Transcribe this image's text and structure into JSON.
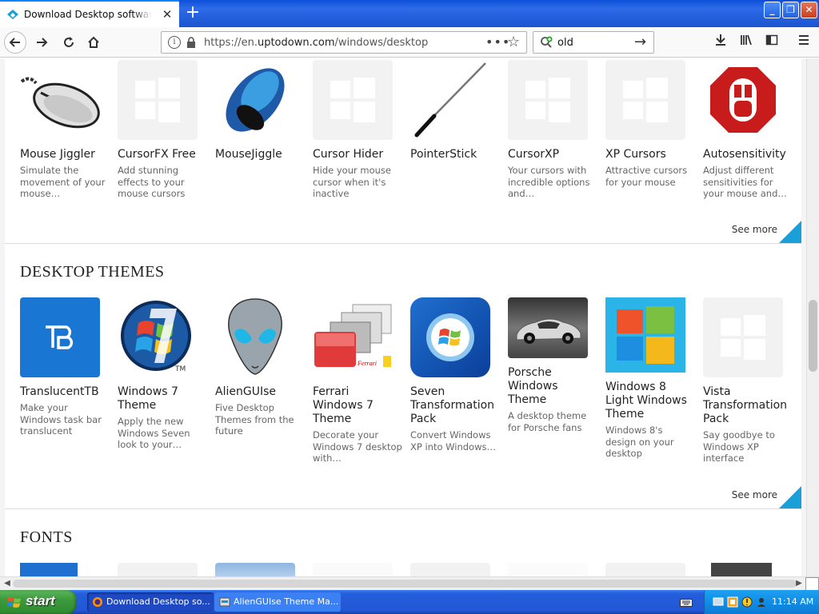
{
  "browser": {
    "tab_title": "Download Desktop software for Windows",
    "url_scheme": "https://en.",
    "url_host": "uptodown.com",
    "url_path": "/windows/desktop",
    "search_value": "old"
  },
  "sections": [
    {
      "title": "",
      "see_more": "See more",
      "items": [
        {
          "name": "Mouse Jiggler",
          "desc": "Simulate the movement of your mouse…",
          "icon": "pixel-mouse-icon"
        },
        {
          "name": "CursorFX Free",
          "desc": "Add stunning effects to your mouse cursors",
          "icon": "windows-placeholder-icon"
        },
        {
          "name": "MouseJiggle",
          "desc": "",
          "icon": "blue-mouse-icon"
        },
        {
          "name": "Cursor Hider",
          "desc": "Hide your mouse cursor when it's inactive",
          "icon": "windows-placeholder-icon"
        },
        {
          "name": "PointerStick",
          "desc": "",
          "icon": "pointer-stick-icon"
        },
        {
          "name": "CursorXP",
          "desc": "Your cursors with incredible options and…",
          "icon": "windows-placeholder-icon"
        },
        {
          "name": "XP Cursors",
          "desc": "Attractive cursors for your mouse",
          "icon": "windows-placeholder-icon"
        },
        {
          "name": "Autosensitivity",
          "desc": "Adjust different sensitivities for your mouse and…",
          "icon": "red-mouse-badge-icon"
        }
      ]
    },
    {
      "title": "DESKTOP THEMES",
      "see_more": "See more",
      "items": [
        {
          "name": "TranslucentTB",
          "desc": "Make your Windows task bar translucent",
          "icon": "translucenttb-icon"
        },
        {
          "name": "Windows 7 Theme",
          "desc": "Apply the new Windows Seven look to your…",
          "icon": "windows7-orb-icon"
        },
        {
          "name": "AlienGUIse",
          "desc": "Five Desktop Themes from the future",
          "icon": "alien-head-icon"
        },
        {
          "name": "Ferrari Windows 7 Theme",
          "desc": "Decorate your Windows 7 desktop with…",
          "icon": "ferrari-windows-icon"
        },
        {
          "name": "Seven Transformation Pack",
          "desc": "Convert Windows XP into Windows…",
          "icon": "seven-transformation-icon"
        },
        {
          "name": "Porsche Windows Theme",
          "desc": "A desktop theme for Porsche fans",
          "icon": "porsche-car-icon"
        },
        {
          "name": "Windows 8 Light Windows Theme",
          "desc": "Windows 8's design on your desktop",
          "icon": "windows8-logo-icon"
        },
        {
          "name": "Vista Transformation Pack",
          "desc": "Say goodbye to Windows XP interface",
          "icon": "windows-placeholder-icon"
        }
      ]
    },
    {
      "title": "FONTS"
    }
  ],
  "taskbar": {
    "start_label": "start",
    "tasks": [
      "Download Desktop so...",
      "AlienGUIse Theme Ma..."
    ],
    "clock": "11:14 AM"
  },
  "colors": {
    "accent": "#1aa0d9",
    "xp_blue": "#245edb",
    "start_green": "#3c9a3c"
  }
}
